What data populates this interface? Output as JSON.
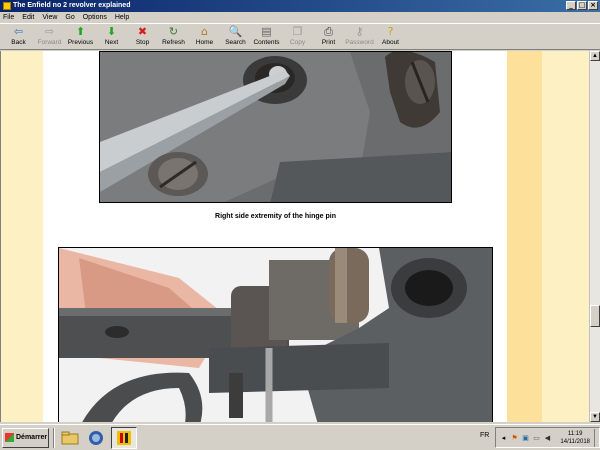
{
  "window": {
    "title": "The Enfield no 2 revolver explained",
    "buttons": [
      "_",
      "□",
      "×"
    ]
  },
  "menu": [
    "File",
    "Edit",
    "View",
    "Go",
    "Options",
    "Help"
  ],
  "toolbar": [
    {
      "label": "Back",
      "icon": "back-arrow-icon",
      "glyph": "⇦",
      "color": "#2e7bbf",
      "enabled": true
    },
    {
      "label": "Forward",
      "icon": "forward-arrow-icon",
      "glyph": "⇨",
      "color": "#9a9a9a",
      "enabled": false
    },
    {
      "label": "Previous",
      "icon": "previous-up-arrow-icon",
      "glyph": "⬆",
      "color": "#1fa61f",
      "enabled": true
    },
    {
      "label": "Next",
      "icon": "next-down-arrow-icon",
      "glyph": "⬇",
      "color": "#1fa61f",
      "enabled": true
    },
    {
      "label": "Stop",
      "icon": "stop-icon",
      "glyph": "✖",
      "color": "#d91a1a",
      "enabled": true
    },
    {
      "label": "Refresh",
      "icon": "refresh-icon",
      "glyph": "↻",
      "color": "#3a7a3a",
      "enabled": true
    },
    {
      "label": "Home",
      "icon": "home-icon",
      "glyph": "⌂",
      "color": "#b07a2a",
      "enabled": true
    },
    {
      "label": "Search",
      "icon": "search-icon",
      "glyph": "🔍",
      "color": "#555555",
      "enabled": true
    },
    {
      "label": "Contents",
      "icon": "contents-icon",
      "glyph": "▤",
      "color": "#666666",
      "enabled": true
    },
    {
      "label": "Copy",
      "icon": "copy-icon",
      "glyph": "❐",
      "color": "#9a9a9a",
      "enabled": false
    },
    {
      "label": "Print",
      "icon": "print-icon",
      "glyph": "⎙",
      "color": "#444444",
      "enabled": true
    },
    {
      "label": "Password",
      "icon": "key-icon",
      "glyph": "⚷",
      "color": "#9a9a9a",
      "enabled": false
    },
    {
      "label": "About",
      "icon": "about-icon",
      "glyph": "?",
      "color": "#c9a020",
      "enabled": true
    }
  ],
  "page": {
    "caption": "Right side extremity of the hinge pin"
  },
  "taskbar": {
    "start_label": "Démarrer",
    "language": "FR",
    "time": "11:19",
    "date": "14/11/2018"
  }
}
